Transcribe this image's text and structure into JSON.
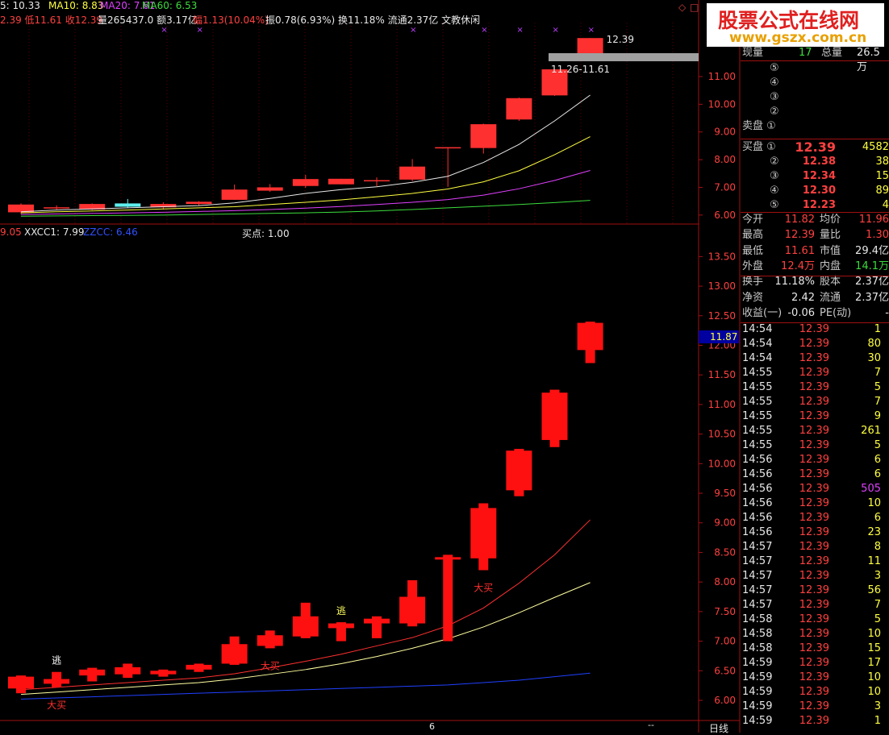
{
  "header": {
    "ma_items": [
      {
        "text": "5: 10.33",
        "color": "#e8e8e8"
      },
      {
        "text": "MA10: 8.83",
        "color": "#ffff40"
      },
      {
        "text": "MA20: 7.61",
        "color": "#e040ff"
      },
      {
        "text": "MA60: 6.53",
        "color": "#3cdc3c"
      }
    ],
    "info_items": [
      {
        "text": "2.39 低11.61 收12.39",
        "color": "#ff4040"
      },
      {
        "text": "量265437.0 额3.17亿",
        "color": "#e8e8e8"
      },
      {
        "text": "幅1.13(10.04%)",
        "color": "#ff4040"
      },
      {
        "text": "振0.78(6.93%) 换11.18% 流通2.37亿 文教休闲",
        "color": "#e8e8e8"
      }
    ],
    "ind_items": [
      {
        "text": "9.05",
        "color": "#ff4040"
      },
      {
        "text": "XXCC1: 7.99",
        "color": "#e8e8e8"
      },
      {
        "text": "ZZCC: 6.46",
        "color": "#3050ff"
      }
    ],
    "buy_point": "买点: 1.00"
  },
  "logo": {
    "title": "股票公式在线网",
    "url": "www.gszx.com.cn"
  },
  "chart_data": [
    {
      "type": "candlestick",
      "title": "",
      "ylim": [
        5.85,
        12.6
      ],
      "yticks": [
        "11.00",
        "10.00",
        "9.00",
        "8.00",
        "7.00",
        "6.00"
      ],
      "ytick_values": [
        11,
        10,
        9,
        8,
        7,
        6
      ],
      "candles": [
        {
          "o": 6.1,
          "h": 6.42,
          "l": 6.04,
          "c": 6.38
        },
        {
          "o": 6.28,
          "h": 6.35,
          "l": 6.2,
          "c": 6.28
        },
        {
          "o": 6.2,
          "h": 6.42,
          "l": 6.18,
          "c": 6.4
        },
        {
          "o": 6.42,
          "h": 6.58,
          "l": 6.26,
          "c": 6.3
        },
        {
          "o": 6.28,
          "h": 6.46,
          "l": 6.2,
          "c": 6.4
        },
        {
          "o": 6.4,
          "h": 6.5,
          "l": 6.34,
          "c": 6.48
        },
        {
          "o": 6.55,
          "h": 7.1,
          "l": 6.55,
          "c": 6.92
        },
        {
          "o": 6.88,
          "h": 7.12,
          "l": 6.84,
          "c": 7.0
        },
        {
          "o": 7.05,
          "h": 7.45,
          "l": 6.98,
          "c": 7.3
        },
        {
          "o": 7.31,
          "h": 7.31,
          "l": 7.11,
          "c": 7.11
        },
        {
          "o": 7.22,
          "h": 7.36,
          "l": 7.04,
          "c": 7.26
        },
        {
          "o": 7.28,
          "h": 8.02,
          "l": 7.22,
          "c": 7.75
        },
        {
          "o": 8.45,
          "h": 8.45,
          "l": 7.02,
          "c": 8.45
        },
        {
          "o": 8.42,
          "h": 9.3,
          "l": 8.22,
          "c": 9.28
        },
        {
          "o": 9.45,
          "h": 10.24,
          "l": 9.4,
          "c": 10.22
        },
        {
          "o": 10.32,
          "h": 11.26,
          "l": 10.3,
          "c": 11.26
        },
        {
          "o": 11.82,
          "h": 12.39,
          "l": 11.61,
          "c": 12.39
        }
      ],
      "ma": [
        {
          "name": "MA5",
          "color": "#e8e8e8",
          "values": [
            6.12,
            6.18,
            6.22,
            6.26,
            6.3,
            6.34,
            6.44,
            6.6,
            6.78,
            6.92,
            7.02,
            7.18,
            7.4,
            7.9,
            8.55,
            9.4,
            10.33
          ]
        },
        {
          "name": "MA10",
          "color": "#ffff40",
          "values": [
            6.08,
            6.12,
            6.15,
            6.18,
            6.22,
            6.26,
            6.3,
            6.38,
            6.46,
            6.55,
            6.66,
            6.78,
            6.94,
            7.2,
            7.6,
            8.18,
            8.83
          ]
        },
        {
          "name": "MA20",
          "color": "#e040ff",
          "values": [
            6.02,
            6.04,
            6.06,
            6.08,
            6.1,
            6.13,
            6.16,
            6.2,
            6.25,
            6.31,
            6.38,
            6.46,
            6.56,
            6.72,
            6.95,
            7.25,
            7.61
          ]
        },
        {
          "name": "MA60",
          "color": "#3cdc3c",
          "values": [
            5.96,
            5.97,
            5.98,
            5.99,
            6.0,
            6.02,
            6.04,
            6.06,
            6.08,
            6.11,
            6.15,
            6.2,
            6.26,
            6.32,
            6.38,
            6.45,
            6.53
          ]
        }
      ],
      "annotations": [
        "12.39",
        "11.26-11.61"
      ]
    },
    {
      "type": "candlestick",
      "title": "",
      "ylim": [
        5.85,
        13.75
      ],
      "yticks": [
        "13.50",
        "13.00",
        "12.50",
        "12.00",
        "11.50",
        "11.00",
        "10.50",
        "10.00",
        "9.50",
        "9.00",
        "8.50",
        "8.00",
        "7.50",
        "7.00",
        "6.50",
        "6.00"
      ],
      "ytick_values": [
        13.5,
        13,
        12.5,
        12,
        11.5,
        11,
        10.5,
        10,
        9.5,
        9,
        8.5,
        8,
        7.5,
        7,
        6.5,
        6
      ],
      "current_value": "11.87",
      "candles": [
        {
          "o": 6.2,
          "h": 6.42,
          "l": 6.12,
          "c": 6.4
        },
        {
          "o": 6.28,
          "h": 6.48,
          "l": 6.22,
          "c": 6.36
        },
        {
          "o": 6.42,
          "h": 6.55,
          "l": 6.32,
          "c": 6.52
        },
        {
          "o": 6.44,
          "h": 6.62,
          "l": 6.38,
          "c": 6.56
        },
        {
          "o": 6.44,
          "h": 6.52,
          "l": 6.4,
          "c": 6.5
        },
        {
          "o": 6.52,
          "h": 6.62,
          "l": 6.48,
          "c": 6.6
        },
        {
          "o": 6.62,
          "h": 7.08,
          "l": 6.6,
          "c": 6.95
        },
        {
          "o": 6.92,
          "h": 7.18,
          "l": 6.88,
          "c": 7.1
        },
        {
          "o": 7.08,
          "h": 7.65,
          "l": 7.05,
          "c": 7.42
        },
        {
          "o": 7.3,
          "h": 7.32,
          "l": 7.0,
          "c": 7.22
        },
        {
          "o": 7.3,
          "h": 7.42,
          "l": 7.05,
          "c": 7.38
        },
        {
          "o": 7.3,
          "h": 8.03,
          "l": 7.25,
          "c": 7.75
        },
        {
          "o": 8.42,
          "h": 8.46,
          "l": 7.0,
          "c": 8.42
        },
        {
          "o": 8.4,
          "h": 9.33,
          "l": 8.2,
          "c": 9.25
        },
        {
          "o": 9.55,
          "h": 10.25,
          "l": 9.45,
          "c": 10.22
        },
        {
          "o": 10.4,
          "h": 11.25,
          "l": 10.28,
          "c": 11.2
        },
        {
          "o": 11.92,
          "h": 12.4,
          "l": 11.7,
          "c": 12.38
        }
      ],
      "lines": [
        {
          "name": "",
          "color": "#ff3030",
          "values": [
            6.18,
            6.22,
            6.26,
            6.3,
            6.34,
            6.38,
            6.45,
            6.55,
            6.66,
            6.78,
            6.92,
            7.06,
            7.26,
            7.56,
            7.98,
            8.46,
            9.05
          ]
        },
        {
          "name": "XXCC1",
          "color": "#ffffa0",
          "values": [
            6.1,
            6.14,
            6.18,
            6.22,
            6.26,
            6.3,
            6.36,
            6.44,
            6.52,
            6.62,
            6.74,
            6.88,
            7.04,
            7.24,
            7.48,
            7.74,
            7.99
          ]
        },
        {
          "name": "ZZCC",
          "color": "#2040ff",
          "values": [
            6.02,
            6.04,
            6.06,
            6.08,
            6.1,
            6.12,
            6.14,
            6.16,
            6.18,
            6.2,
            6.22,
            6.24,
            6.26,
            6.3,
            6.34,
            6.4,
            6.46
          ]
        }
      ],
      "labels": [
        {
          "candle": 1,
          "text": "逃",
          "color": "#ffffff",
          "pos": "above"
        },
        {
          "candle": 1,
          "text": "大买",
          "color": "#ff3030",
          "pos": "below"
        },
        {
          "candle": 7,
          "text": "大买",
          "color": "#ff3030",
          "pos": "below"
        },
        {
          "candle": 9,
          "text": "逃",
          "color": "#ffff60",
          "pos": "above"
        },
        {
          "candle": 13,
          "text": "大买",
          "color": "#ff3030",
          "pos": "below"
        }
      ]
    }
  ],
  "footer": {
    "date_label": "6",
    "mode_label": "日线",
    "scroll_mark": "--"
  },
  "quote": {
    "top_row": {
      "label1": "现量",
      "val1": "17",
      "label2": "总量",
      "val2": "26.5万"
    },
    "sell": [
      {
        "label": "⑤",
        "price": "",
        "vol": ""
      },
      {
        "label": "④",
        "price": "",
        "vol": ""
      },
      {
        "label": "③",
        "price": "",
        "vol": ""
      },
      {
        "label": "②",
        "price": "",
        "vol": ""
      },
      {
        "label": "卖盘 ①",
        "price": "",
        "vol": ""
      }
    ],
    "buy": [
      {
        "label": "买盘 ①",
        "price": "12.39",
        "vol": "4582"
      },
      {
        "label": "②",
        "price": "12.38",
        "vol": "38"
      },
      {
        "label": "③",
        "price": "12.34",
        "vol": "15"
      },
      {
        "label": "④",
        "price": "12.30",
        "vol": "89"
      },
      {
        "label": "⑤",
        "price": "12.23",
        "vol": "4"
      }
    ],
    "stats": [
      {
        "l1": "今开",
        "v1": "11.82",
        "c1": "red",
        "l2": "均价",
        "v2": "11.96",
        "c2": "red"
      },
      {
        "l1": "最高",
        "v1": "12.39",
        "c1": "red",
        "l2": "量比",
        "v2": "1.30",
        "c2": "red"
      },
      {
        "l1": "最低",
        "v1": "11.61",
        "c1": "red",
        "l2": "市值",
        "v2": "29.4亿",
        "c2": "wht"
      },
      {
        "l1": "外盘",
        "v1": "12.4万",
        "c1": "red",
        "l2": "内盘",
        "v2": "14.1万",
        "c2": "grn"
      },
      {
        "l1": "换手",
        "v1": "11.18%",
        "c1": "wht",
        "l2": "股本",
        "v2": "2.37亿",
        "c2": "wht"
      },
      {
        "l1": "净资",
        "v1": "2.42",
        "c1": "wht",
        "l2": "流通",
        "v2": "2.37亿",
        "c2": "wht"
      },
      {
        "l1": "收益(一)",
        "v1": "-0.06",
        "c1": "wht",
        "l2": "PE(动)",
        "v2": "-",
        "c2": "wht"
      }
    ],
    "ticks": [
      {
        "t": "14:54",
        "p": "12.39",
        "v": "1",
        "c": "yel"
      },
      {
        "t": "14:54",
        "p": "12.39",
        "v": "80",
        "c": "yel"
      },
      {
        "t": "14:54",
        "p": "12.39",
        "v": "30",
        "c": "yel"
      },
      {
        "t": "14:55",
        "p": "12.39",
        "v": "7",
        "c": "yel"
      },
      {
        "t": "14:55",
        "p": "12.39",
        "v": "5",
        "c": "yel"
      },
      {
        "t": "14:55",
        "p": "12.39",
        "v": "7",
        "c": "yel"
      },
      {
        "t": "14:55",
        "p": "12.39",
        "v": "9",
        "c": "yel"
      },
      {
        "t": "14:55",
        "p": "12.39",
        "v": "261",
        "c": "yel"
      },
      {
        "t": "14:55",
        "p": "12.39",
        "v": "5",
        "c": "yel"
      },
      {
        "t": "14:56",
        "p": "12.39",
        "v": "6",
        "c": "yel"
      },
      {
        "t": "14:56",
        "p": "12.39",
        "v": "6",
        "c": "yel"
      },
      {
        "t": "14:56",
        "p": "12.39",
        "v": "505",
        "c": "pur"
      },
      {
        "t": "14:56",
        "p": "12.39",
        "v": "10",
        "c": "yel"
      },
      {
        "t": "14:56",
        "p": "12.39",
        "v": "6",
        "c": "yel"
      },
      {
        "t": "14:56",
        "p": "12.39",
        "v": "23",
        "c": "yel"
      },
      {
        "t": "14:57",
        "p": "12.39",
        "v": "8",
        "c": "yel"
      },
      {
        "t": "14:57",
        "p": "12.39",
        "v": "11",
        "c": "yel"
      },
      {
        "t": "14:57",
        "p": "12.39",
        "v": "3",
        "c": "yel"
      },
      {
        "t": "14:57",
        "p": "12.39",
        "v": "56",
        "c": "yel"
      },
      {
        "t": "14:57",
        "p": "12.39",
        "v": "7",
        "c": "yel"
      },
      {
        "t": "14:58",
        "p": "12.39",
        "v": "5",
        "c": "yel"
      },
      {
        "t": "14:58",
        "p": "12.39",
        "v": "10",
        "c": "yel"
      },
      {
        "t": "14:58",
        "p": "12.39",
        "v": "15",
        "c": "yel"
      },
      {
        "t": "14:59",
        "p": "12.39",
        "v": "17",
        "c": "yel"
      },
      {
        "t": "14:59",
        "p": "12.39",
        "v": "10",
        "c": "yel"
      },
      {
        "t": "14:59",
        "p": "12.39",
        "v": "10",
        "c": "yel"
      },
      {
        "t": "14:59",
        "p": "12.39",
        "v": "3",
        "c": "yel"
      },
      {
        "t": "14:59",
        "p": "12.39",
        "v": "1",
        "c": "yel"
      }
    ]
  }
}
